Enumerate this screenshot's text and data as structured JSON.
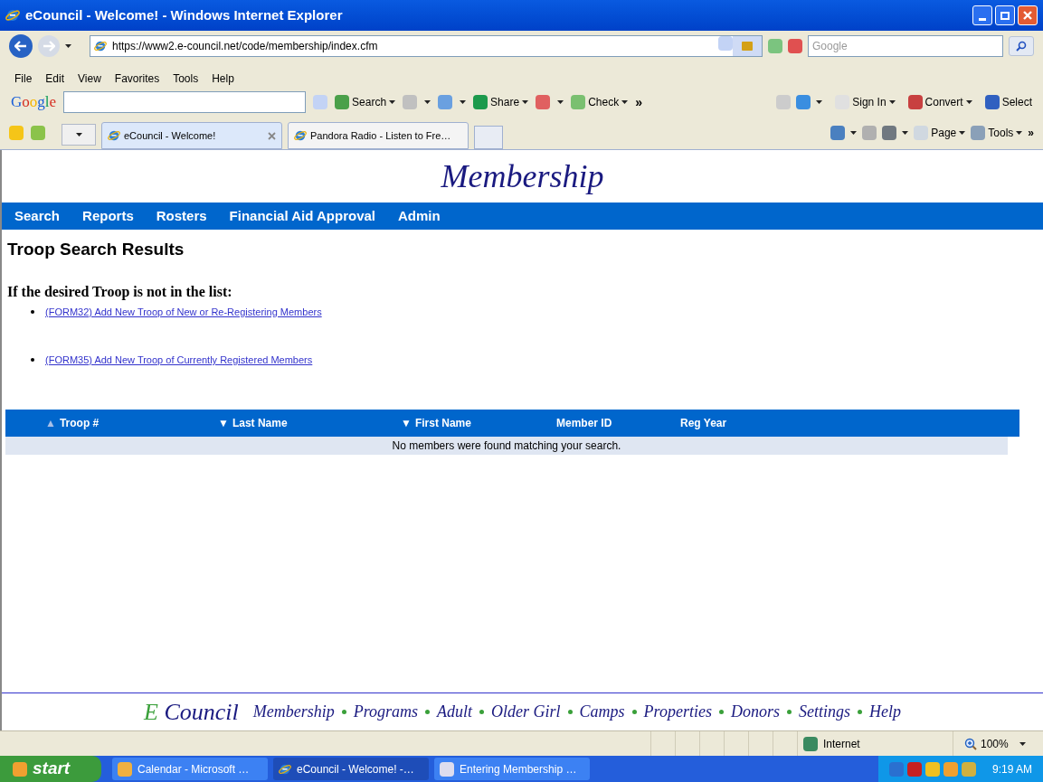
{
  "window": {
    "title": "eCouncil - Welcome! - Windows Internet Explorer"
  },
  "address_bar": {
    "url": "https://www2.e-council.net/code/membership/index.cfm"
  },
  "search_box": {
    "placeholder": "Google"
  },
  "menu": [
    "File",
    "Edit",
    "View",
    "Favorites",
    "Tools",
    "Help"
  ],
  "google_toolbar": {
    "logo": "Google",
    "left_buttons": [
      "Search",
      "Share",
      "Check",
      "»"
    ],
    "right_buttons": [
      "Sign In",
      "Convert",
      "Select"
    ]
  },
  "tabs": [
    {
      "label": "eCouncil - Welcome!",
      "selected": true
    },
    {
      "label": "Pandora Radio - Listen to Fre…",
      "selected": false
    }
  ],
  "command_bar": [
    "Page",
    "Tools",
    "»"
  ],
  "page": {
    "title": "Membership",
    "nav": [
      "Search",
      "Reports",
      "Rosters",
      "Financial Aid Approval",
      "Admin"
    ],
    "heading": "Troop Search Results",
    "subheading": "If the desired Troop is not in the list:",
    "links": [
      "(FORM32) Add New Troop of New or Re-Registering Members",
      "(FORM35) Add New Troop of Currently Registered Members"
    ],
    "table": {
      "columns": [
        {
          "label": "Troop #",
          "arrow": "▲",
          "active": false
        },
        {
          "label": "Last Name",
          "arrow": "▼",
          "active": true
        },
        {
          "label": "First Name",
          "arrow": "▼",
          "active": true
        },
        {
          "label": "Member ID"
        },
        {
          "label": "Reg Year"
        }
      ],
      "empty_message": "No members were found matching your search."
    },
    "footer": {
      "brand_initial": "E",
      "brand": "Council",
      "links": [
        "Membership",
        "Programs",
        "Adult",
        "Older Girl",
        "Camps",
        "Properties",
        "Donors",
        "Settings",
        "Help"
      ]
    }
  },
  "status_bar": {
    "zone": "Internet",
    "zoom": "100%"
  },
  "taskbar": {
    "start": "start",
    "items": [
      {
        "label": "Calendar - Microsoft …",
        "selected": false
      },
      {
        "label": "eCouncil - Welcome! -…",
        "selected": true
      },
      {
        "label": "Entering Membership …",
        "selected": false
      }
    ],
    "clock": "9:19 AM"
  }
}
